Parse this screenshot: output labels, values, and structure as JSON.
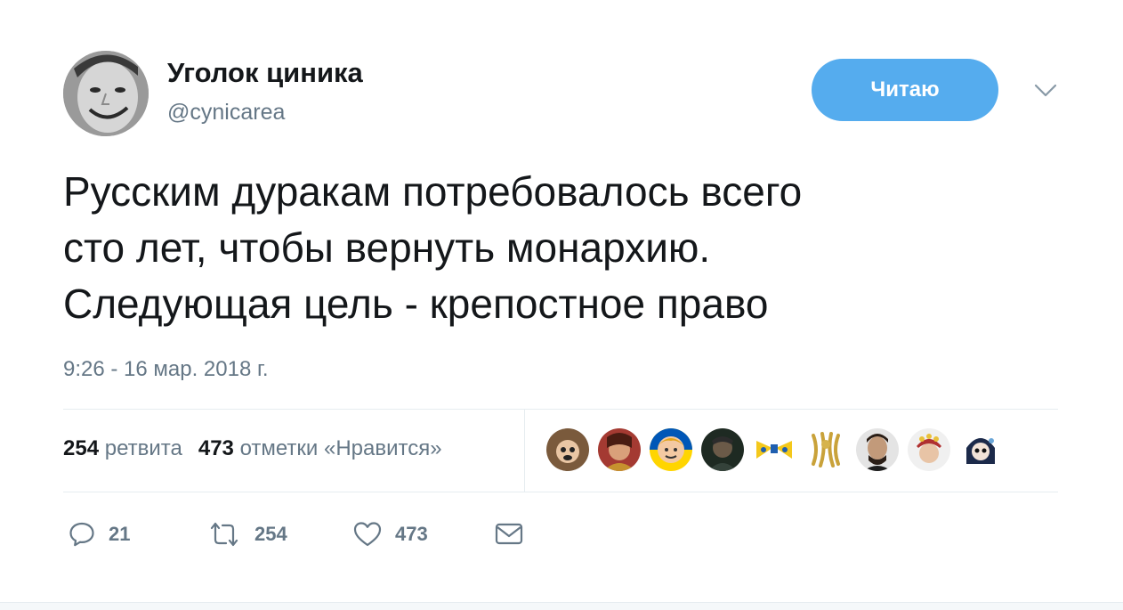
{
  "author": {
    "name": "Уголок циника",
    "handle": "@cynicarea"
  },
  "follow_button": {
    "label": "Читаю"
  },
  "icons": {
    "more": "chevron-down-icon",
    "reply": "reply-bubble-icon",
    "retweet": "retweet-icon",
    "like": "heart-icon",
    "message": "envelope-icon"
  },
  "tweet": {
    "lines": [
      "Русским дуракам потребовалось всего",
      "сто лет, чтобы вернуть монархию.",
      "Следующая цель - крепостное право"
    ],
    "timestamp": "9:26 - 16 мар. 2018 г."
  },
  "stats": {
    "retweets_count": "254",
    "retweets_label": "ретвита",
    "likes_count": "473",
    "likes_label": "отметки «Нравится»"
  },
  "actions": {
    "reply_count": "21",
    "retweet_count": "254",
    "like_count": "473"
  },
  "colors": {
    "accent": "#55acee",
    "muted": "#657786",
    "text": "#14171a",
    "divider": "#e6ecf0"
  }
}
